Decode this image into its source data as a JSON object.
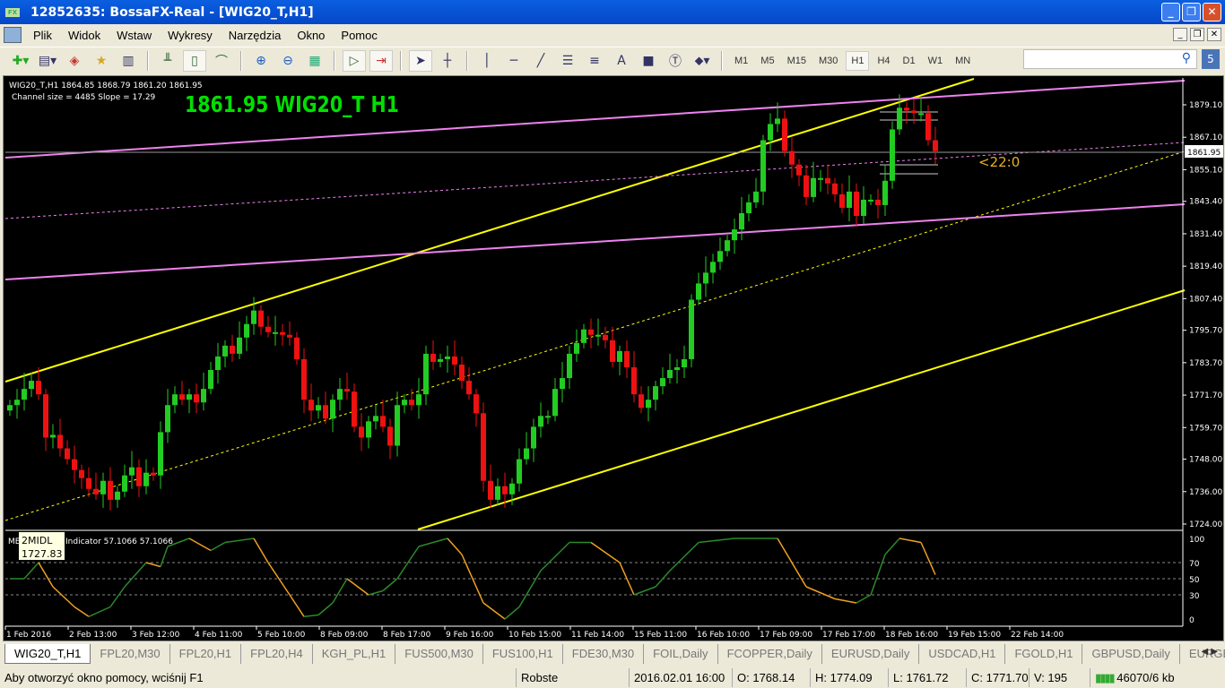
{
  "window": {
    "title": "12852635: BossaFX-Real - [WIG20_T,H1]",
    "logo": "FX",
    "buttons": [
      "_",
      "❐",
      "✕"
    ]
  },
  "menu": [
    "Plik",
    "Widok",
    "Wstaw",
    "Wykresy",
    "Narzędzia",
    "Okno",
    "Pomoc"
  ],
  "toolbar": {
    "timeframes": [
      "M1",
      "M5",
      "M15",
      "M30",
      "H1",
      "H4",
      "D1",
      "W1",
      "MN"
    ],
    "active_timeframe": "H1",
    "search_placeholder": "",
    "search_badge": "5"
  },
  "chart": {
    "header": "WIG20_T,H1  1864.85 1868.79 1861.20 1861.95",
    "channel_info": "Channel size = 4485 Slope = 17.29",
    "big_label": "1861.95 WIG20_T H1",
    "countdown": "<22:0",
    "current_price": "1861.95",
    "price_ticks": [
      "1879.10",
      "1867.10",
      "1855.10",
      "1843.40",
      "1831.40",
      "1819.40",
      "1807.40",
      "1795.70",
      "1783.70",
      "1771.70",
      "1759.70",
      "1748.00",
      "1736.00",
      "1724.00"
    ],
    "time_ticks": [
      "1 Feb 2016",
      "2 Feb 13:00",
      "3 Feb 12:00",
      "4 Feb 11:00",
      "5 Feb 10:00",
      "8 Feb 09:00",
      "8 Feb 17:00",
      "9 Feb 16:00",
      "10 Feb 15:00",
      "11 Feb 14:00",
      "15 Feb 11:00",
      "16 Feb 10:00",
      "17 Feb 09:00",
      "17 Feb 17:00",
      "18 Feb 16:00",
      "19 Feb 15:00",
      "22 Feb 14:00"
    ],
    "colors": {
      "bull": "#22cc22",
      "bear": "#ee1111",
      "channel": "#ffff00",
      "pink": "#ee82ee",
      "big_label": "#00e000",
      "countdown": "#e8b020"
    }
  },
  "chart_data": {
    "type": "candlestick",
    "symbol": "WIG20_T",
    "timeframe": "H1",
    "ylim": [
      1724.0,
      1879.1
    ],
    "closes": [
      1768,
      1770,
      1774,
      1777,
      1772,
      1756,
      1757,
      1752,
      1748,
      1744,
      1741,
      1737,
      1735,
      1740,
      1733,
      1736,
      1742,
      1745,
      1738,
      1743,
      1742,
      1758,
      1768,
      1772,
      1770,
      1772,
      1769,
      1774,
      1781,
      1786,
      1790,
      1787,
      1793,
      1798,
      1803,
      1797,
      1795,
      1795,
      1794,
      1793,
      1785,
      1770,
      1766,
      1768,
      1763,
      1770,
      1774,
      1773,
      1760,
      1756,
      1762,
      1764,
      1760,
      1753,
      1768,
      1770,
      1768,
      1772,
      1787,
      1784,
      1785,
      1786,
      1783,
      1777,
      1772,
      1765,
      1740,
      1733,
      1738,
      1735,
      1739,
      1748,
      1752,
      1760,
      1764,
      1764,
      1774,
      1778,
      1787,
      1791,
      1796,
      1794,
      1794,
      1792,
      1784,
      1788,
      1782,
      1772,
      1767,
      1770,
      1775,
      1778,
      1781,
      1782,
      1785,
      1807,
      1813,
      1817,
      1821,
      1825,
      1829,
      1833,
      1839,
      1843,
      1847,
      1866,
      1872,
      1874,
      1862,
      1857,
      1853,
      1845,
      1852,
      1852,
      1850,
      1846,
      1841,
      1847,
      1838,
      1844,
      1844,
      1842,
      1851,
      1870,
      1878,
      1877,
      1876,
      1876,
      1866,
      1861.95
    ]
  },
  "indicator": {
    "label": "Indicator 57.1066 57.1066",
    "prefix": "ME",
    "tooltip_name": "2MIDL",
    "tooltip_value": "1727.83",
    "levels": [
      "100",
      "70",
      "50",
      "30",
      "0"
    ],
    "points": [
      [
        0,
        50
      ],
      [
        2,
        50
      ],
      [
        4,
        70
      ],
      [
        6,
        40
      ],
      [
        9,
        15
      ],
      [
        11,
        3
      ],
      [
        14,
        15
      ],
      [
        16,
        40
      ],
      [
        19,
        70
      ],
      [
        21,
        65
      ],
      [
        22,
        90
      ],
      [
        25,
        100
      ],
      [
        28,
        85
      ],
      [
        30,
        95
      ],
      [
        34,
        100
      ],
      [
        36,
        70
      ],
      [
        39,
        30
      ],
      [
        41,
        3
      ],
      [
        43,
        5
      ],
      [
        45,
        20
      ],
      [
        47,
        50
      ],
      [
        50,
        30
      ],
      [
        52,
        35
      ],
      [
        54,
        50
      ],
      [
        57,
        90
      ],
      [
        61,
        100
      ],
      [
        63,
        80
      ],
      [
        66,
        20
      ],
      [
        69,
        0
      ],
      [
        71,
        15
      ],
      [
        74,
        60
      ],
      [
        78,
        95
      ],
      [
        81,
        95
      ],
      [
        85,
        70
      ],
      [
        87,
        30
      ],
      [
        90,
        40
      ],
      [
        92,
        60
      ],
      [
        96,
        95
      ],
      [
        101,
        100
      ],
      [
        107,
        100
      ],
      [
        111,
        40
      ],
      [
        115,
        25
      ],
      [
        118,
        20
      ],
      [
        120,
        30
      ],
      [
        122,
        80
      ],
      [
        124,
        100
      ],
      [
        127,
        95
      ],
      [
        129,
        55
      ]
    ]
  },
  "tabs": [
    "WIG20_T,H1",
    "FPL20,M30",
    "FPL20,H1",
    "FPL20,H4",
    "KGH_PL,H1",
    "FUS500,M30",
    "FUS100,H1",
    "FDE30,M30",
    "FOIL,Daily",
    "FCOPPER,Daily",
    "EURUSD,Daily",
    "USDCAD,H1",
    "FGOLD,H1",
    "GBPUSD,Daily",
    "EURGBP,Daily"
  ],
  "status": {
    "help": "Aby otworzyć okno pomocy, wciśnij F1",
    "profile": "Robste",
    "datetime": "2016.02.01 16:00",
    "open": "O: 1768.14",
    "high": "H: 1774.09",
    "low": "L: 1761.72",
    "close": "C: 1771.70",
    "volume": "V: 195",
    "traffic": "46070/6 kb"
  }
}
